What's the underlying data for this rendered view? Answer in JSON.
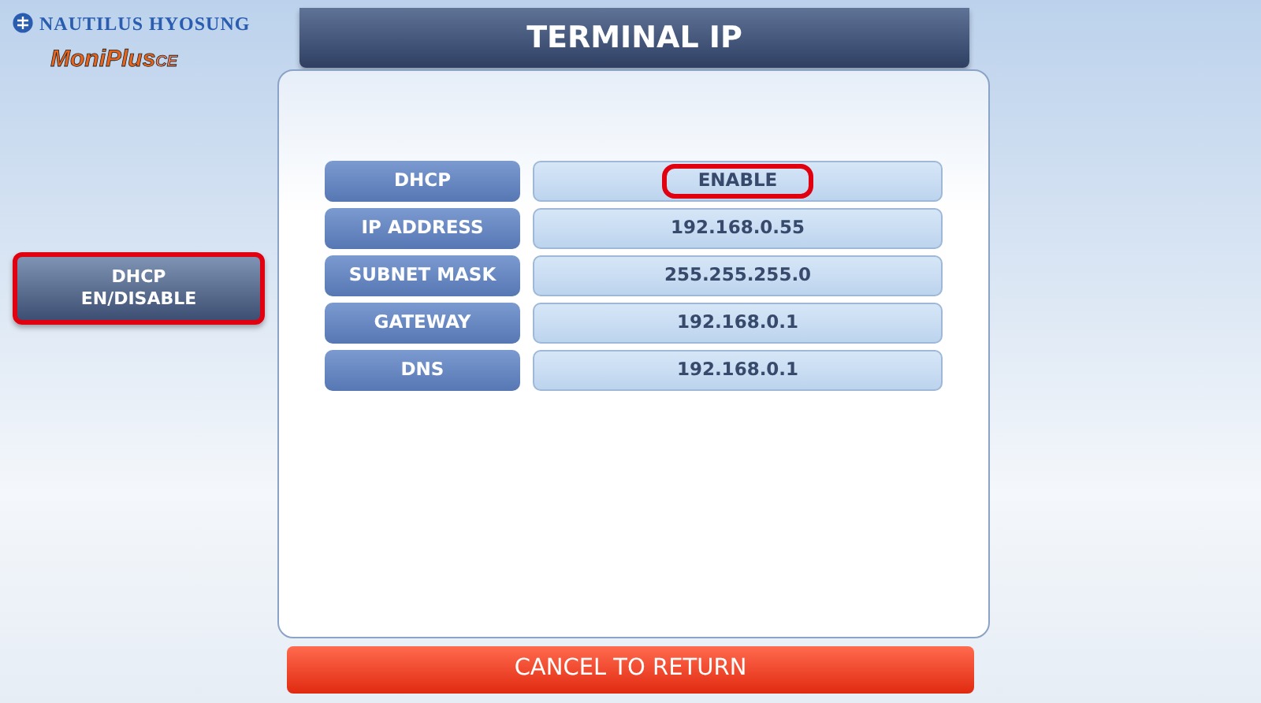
{
  "logo": {
    "brand": "NAUTILUS HYOSUNG",
    "product": "MoniPlus",
    "product_suffix": "CE"
  },
  "title": "TERMINAL IP",
  "side_buttons": [
    {
      "label": "DHCP\nEN/DISABLE",
      "highlighted": true
    }
  ],
  "rows": [
    {
      "label": "DHCP",
      "value": "ENABLE",
      "highlighted": true
    },
    {
      "label": "IP ADDRESS",
      "value": "192.168.0.55",
      "highlighted": false
    },
    {
      "label": "SUBNET MASK",
      "value": "255.255.255.0",
      "highlighted": false
    },
    {
      "label": "GATEWAY",
      "value": "192.168.0.1",
      "highlighted": false
    },
    {
      "label": "DNS",
      "value": "192.168.0.1",
      "highlighted": false
    }
  ],
  "cancel_button": "CANCEL TO RETURN"
}
